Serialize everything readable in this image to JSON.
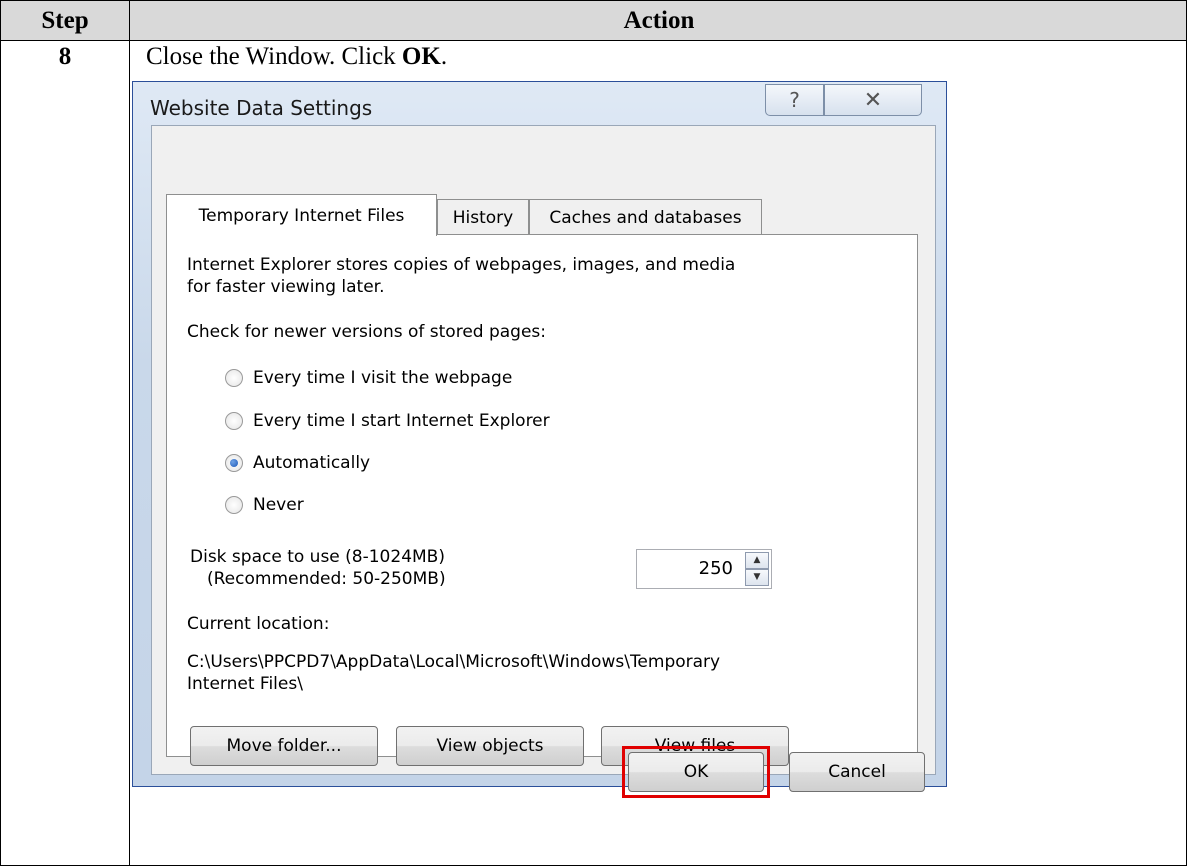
{
  "table": {
    "header_step": "Step",
    "header_action": "Action",
    "step_number": "8",
    "instruction_prefix": "Close the Window. Click ",
    "instruction_bold": "OK",
    "instruction_suffix": "."
  },
  "dialog": {
    "title": "Website Data Settings",
    "help_glyph": "?",
    "close_glyph": "✕",
    "tabs": [
      {
        "label": "Temporary Internet Files",
        "active": true
      },
      {
        "label": "History",
        "active": false
      },
      {
        "label": "Caches and databases",
        "active": false
      }
    ],
    "description_line1": "Internet Explorer stores copies of webpages, images, and media",
    "description_line2": "for faster viewing later.",
    "check_label": "Check for newer versions of stored pages:",
    "radio_options": [
      {
        "label": "Every time I visit the webpage",
        "selected": false
      },
      {
        "label": "Every time I start Internet Explorer",
        "selected": false
      },
      {
        "label": "Automatically",
        "selected": true
      },
      {
        "label": "Never",
        "selected": false
      }
    ],
    "disk_label_line1": "Disk space to use (8-1024MB)",
    "disk_label_line2": "(Recommended: 50-250MB)",
    "disk_value": "250",
    "location_label": "Current location:",
    "location_line1": "C:\\Users\\PPCPD7\\AppData\\Local\\Microsoft\\Windows\\Temporary",
    "location_line2": "Internet Files\\",
    "buttons": {
      "move_folder": "Move folder...",
      "view_objects": "View objects",
      "view_files": "View files",
      "ok": "OK",
      "cancel": "Cancel"
    },
    "highlight_color": "#e00000"
  }
}
